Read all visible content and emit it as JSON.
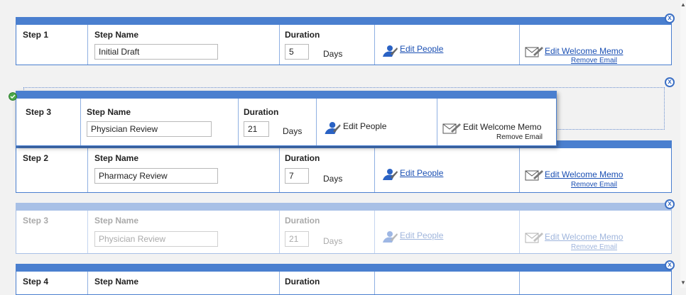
{
  "labels": {
    "step_name": "Step Name",
    "duration": "Duration",
    "days": "Days",
    "edit_people": "Edit People",
    "edit_welcome_memo": "Edit Welcome Memo",
    "remove_email": "Remove Email",
    "close_glyph": "x"
  },
  "steps": [
    {
      "step": "Step 1",
      "name": "Initial Draft",
      "duration": "5"
    },
    {
      "step": "Step 2",
      "name": "Pharmacy Review",
      "duration": "7"
    },
    {
      "step": "Step 3",
      "name": "Physician Review",
      "duration": "21"
    },
    {
      "step": "Step 4",
      "name": "",
      "duration": ""
    }
  ],
  "dragging": {
    "step": "Step 3",
    "name": "Physician Review",
    "duration": "21"
  },
  "colors": {
    "accent": "#4a7fcf",
    "link": "#1a4fb3",
    "ghost": "#a8c0e6",
    "badge": "#4aa84a"
  },
  "icons": {
    "close": "close-circle-icon",
    "people": "people-icon",
    "memo": "envelope-pencil-icon",
    "drag_ok": "check-circle-icon"
  }
}
